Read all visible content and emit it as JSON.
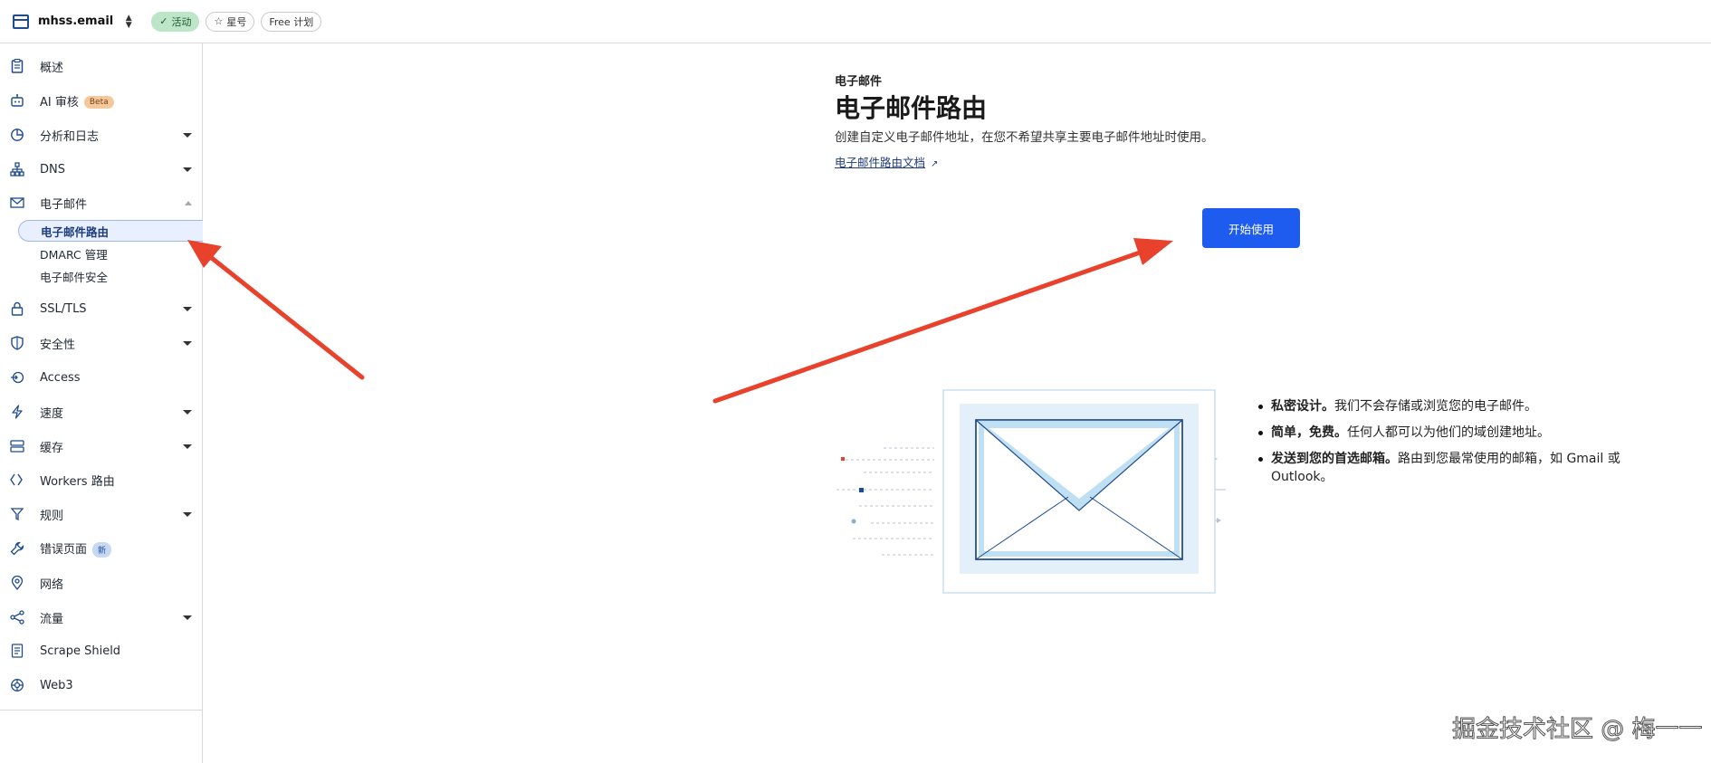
{
  "topbar": {
    "site_name": "mhss.email",
    "status_label": "活动",
    "star_label": "星号",
    "plan_label": "Free 计划"
  },
  "sidebar": {
    "items": [
      {
        "label": "概述",
        "icon": "clipboard-icon"
      },
      {
        "label": "AI 审核",
        "icon": "robot-icon",
        "badge": "Beta"
      },
      {
        "label": "分析和日志",
        "icon": "chart-pie-icon"
      },
      {
        "label": "DNS",
        "icon": "network-icon"
      },
      {
        "label": "电子邮件",
        "icon": "envelope-icon"
      },
      {
        "label": "SSL/TLS",
        "icon": "lock-icon"
      },
      {
        "label": "安全性",
        "icon": "shield-icon"
      },
      {
        "label": "Access",
        "icon": "access-icon"
      },
      {
        "label": "速度",
        "icon": "bolt-icon"
      },
      {
        "label": "缓存",
        "icon": "storage-icon"
      },
      {
        "label": "Workers 路由",
        "icon": "workers-icon"
      },
      {
        "label": "规则",
        "icon": "rules-icon"
      },
      {
        "label": "错误页面",
        "icon": "wrench-icon",
        "badge": "新"
      },
      {
        "label": "网络",
        "icon": "location-pin-icon"
      },
      {
        "label": "流量",
        "icon": "traffic-icon"
      },
      {
        "label": "Scrape Shield",
        "icon": "document-icon"
      },
      {
        "label": "Web3",
        "icon": "web3-icon"
      }
    ],
    "email_subitems": [
      "电子邮件路由",
      "DMARC 管理",
      "电子邮件安全"
    ]
  },
  "main": {
    "eyebrow": "电子邮件",
    "title": "电子邮件路由",
    "description": "创建自定义电子邮件地址，在您不希望共享主要电子邮件地址时使用。",
    "doc_link": "电子邮件路由文档",
    "cta_label": "开始使用",
    "features": [
      {
        "bold": "私密设计。",
        "text": "我们不会存储或浏览您的电子邮件。"
      },
      {
        "bold": "简单，免费。",
        "text": "任何人都可以为他们的域创建地址。"
      },
      {
        "bold": "发送到您的首选邮箱。",
        "text": "路由到您最常使用的邮箱，如 Gmail 或 Outlook。"
      }
    ]
  },
  "watermark": "掘金技术社区 @ 梅一一",
  "colors": {
    "accent": "#1e5cf0",
    "nav_icon": "#1f4b8f",
    "annotation_arrow": "#e8412c",
    "active_pill": "#bde5c8"
  }
}
